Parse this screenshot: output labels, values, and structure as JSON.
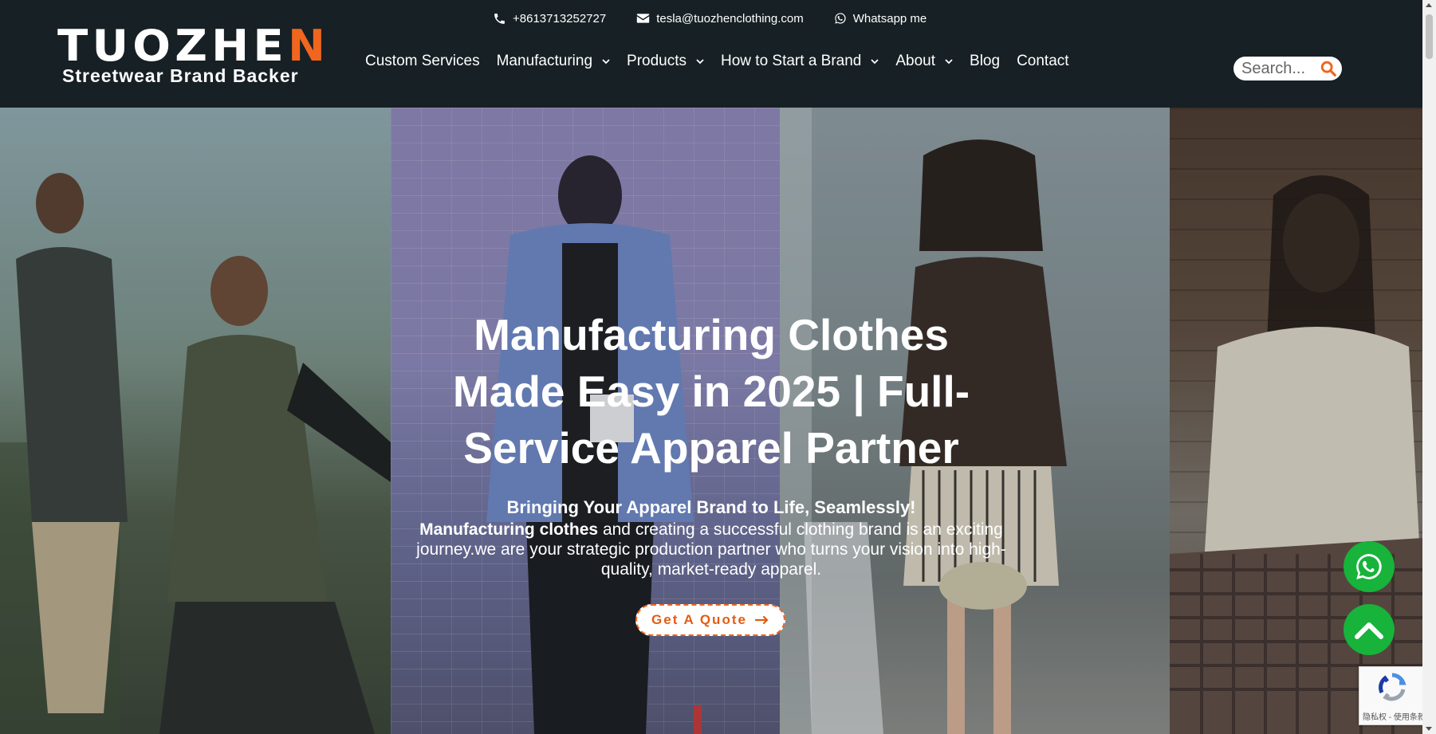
{
  "brand": {
    "logo_main_prefix": "TUOZHE",
    "logo_main_accent": "N",
    "logo_sub": "Streetwear Brand Backer"
  },
  "topbar": {
    "phone": "+8613713252727",
    "email": "tesla@tuozhenclothing.com",
    "whatsapp": "Whatsapp me"
  },
  "nav": [
    {
      "label": "Custom Services",
      "dropdown": false
    },
    {
      "label": "Manufacturing",
      "dropdown": true
    },
    {
      "label": "Products",
      "dropdown": true
    },
    {
      "label": "How to Start a Brand",
      "dropdown": true
    },
    {
      "label": "About",
      "dropdown": true
    },
    {
      "label": "Blog",
      "dropdown": false
    },
    {
      "label": "Contact",
      "dropdown": false
    }
  ],
  "search": {
    "placeholder": "Search..."
  },
  "hero": {
    "title": "Manufacturing Clothes Made Easy in 2025 | Full-Service Apparel Partner",
    "subtitle": "Bringing Your Apparel Brand to Life, Seamlessly!",
    "body_bold": "Manufacturing clothes",
    "body_rest": " and creating a successful clothing brand is an exciting journey.we are your strategic production partner who turns your vision into high-quality, market-ready apparel.",
    "cta": "Get A Quote"
  },
  "recaptcha": {
    "text": "隐私权 - 使用条款"
  },
  "colors": {
    "header_bg": "#172024",
    "accent": "#f0661f",
    "whatsapp_green": "#17b33a"
  },
  "icons": [
    "phone-icon",
    "mail-icon",
    "whatsapp-icon",
    "chevron-down-icon",
    "search-icon",
    "arrow-right-icon",
    "chevron-up-icon"
  ]
}
